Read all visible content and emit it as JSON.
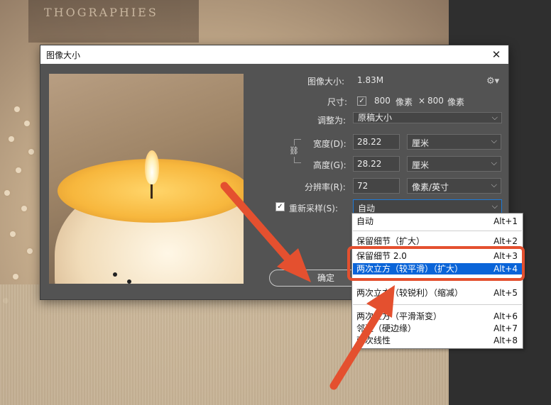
{
  "background": {
    "book_text": "THOGRAPHIES"
  },
  "dialog": {
    "title": "图像大小",
    "image_size_label": "图像大小:",
    "image_size_value": "1.83M",
    "dimensions_label": "尺寸:",
    "dimensions_width": "800",
    "dimensions_unit1": "像素",
    "dimensions_times": "×",
    "dimensions_height": "800",
    "dimensions_unit2": "像素",
    "fit_to_label": "调整为:",
    "fit_to_value": "原稿大小",
    "width_label": "宽度(D):",
    "width_value": "28.22",
    "width_unit": "厘米",
    "height_label": "高度(G):",
    "height_value": "28.22",
    "height_unit": "厘米",
    "resolution_label": "分辨率(R):",
    "resolution_value": "72",
    "resolution_unit": "像素/英寸",
    "resample_label": "重新采样(S):",
    "resample_value": "自动",
    "ok_label": "确定",
    "close_symbol": "✕",
    "gear_symbol": "⚙▾",
    "chevron": "⌵",
    "link_symbol": "🔗"
  },
  "resample_menu": {
    "items": [
      {
        "label": "自动",
        "shortcut": "Alt+1"
      },
      {
        "label": "保留细节（扩大）",
        "shortcut": "Alt+2"
      },
      {
        "label": "保留细节 2.0",
        "shortcut": "Alt+3"
      },
      {
        "label": "两次立方（较平滑）（扩大）",
        "shortcut": "Alt+4",
        "selected": true
      },
      {
        "label": "两次立方（较锐利）（缩减）",
        "shortcut": "Alt+5"
      },
      {
        "label": "两次立方（平滑渐变）",
        "shortcut": "Alt+6"
      },
      {
        "label": "邻近（硬边缘）",
        "shortcut": "Alt+7"
      },
      {
        "label": "两次线性",
        "shortcut": "Alt+8"
      }
    ]
  },
  "colors": {
    "highlight": "#e4502f",
    "selected": "#0a64d8",
    "dialog_bg": "#535353"
  }
}
